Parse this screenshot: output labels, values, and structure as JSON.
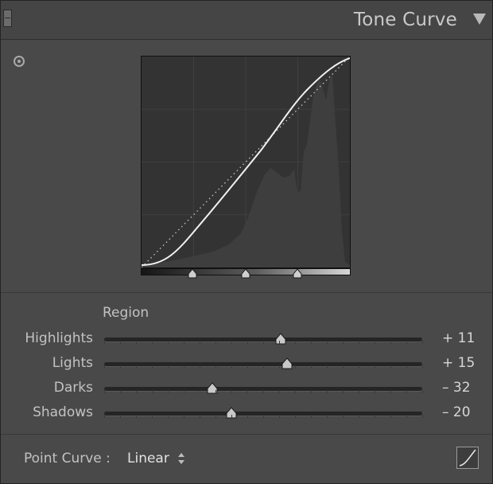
{
  "header": {
    "title": "Tone Curve"
  },
  "icons": {
    "collapse": "panel-collapse-icon",
    "disclosure": "disclosure-triangle-icon",
    "target": "targeted-adjustment-icon",
    "edit_curve": "edit-point-curve-icon"
  },
  "region": {
    "label": "Region",
    "sliders": [
      {
        "key": "highlights",
        "label": "Highlights",
        "value_text": "+ 11",
        "value": 11
      },
      {
        "key": "lights",
        "label": "Lights",
        "value_text": "+ 15",
        "value": 15
      },
      {
        "key": "darks",
        "label": "Darks",
        "value_text": "– 32",
        "value": -32
      },
      {
        "key": "shadows",
        "label": "Shadows",
        "value_text": "– 20",
        "value": -20
      }
    ]
  },
  "point_curve": {
    "label": "Point Curve :",
    "value": "Linear"
  },
  "colors": {
    "panel_bg": "#494949",
    "curve_bg": "#333333",
    "curve_line": "#ffffff",
    "text": "#c2c2c2"
  }
}
